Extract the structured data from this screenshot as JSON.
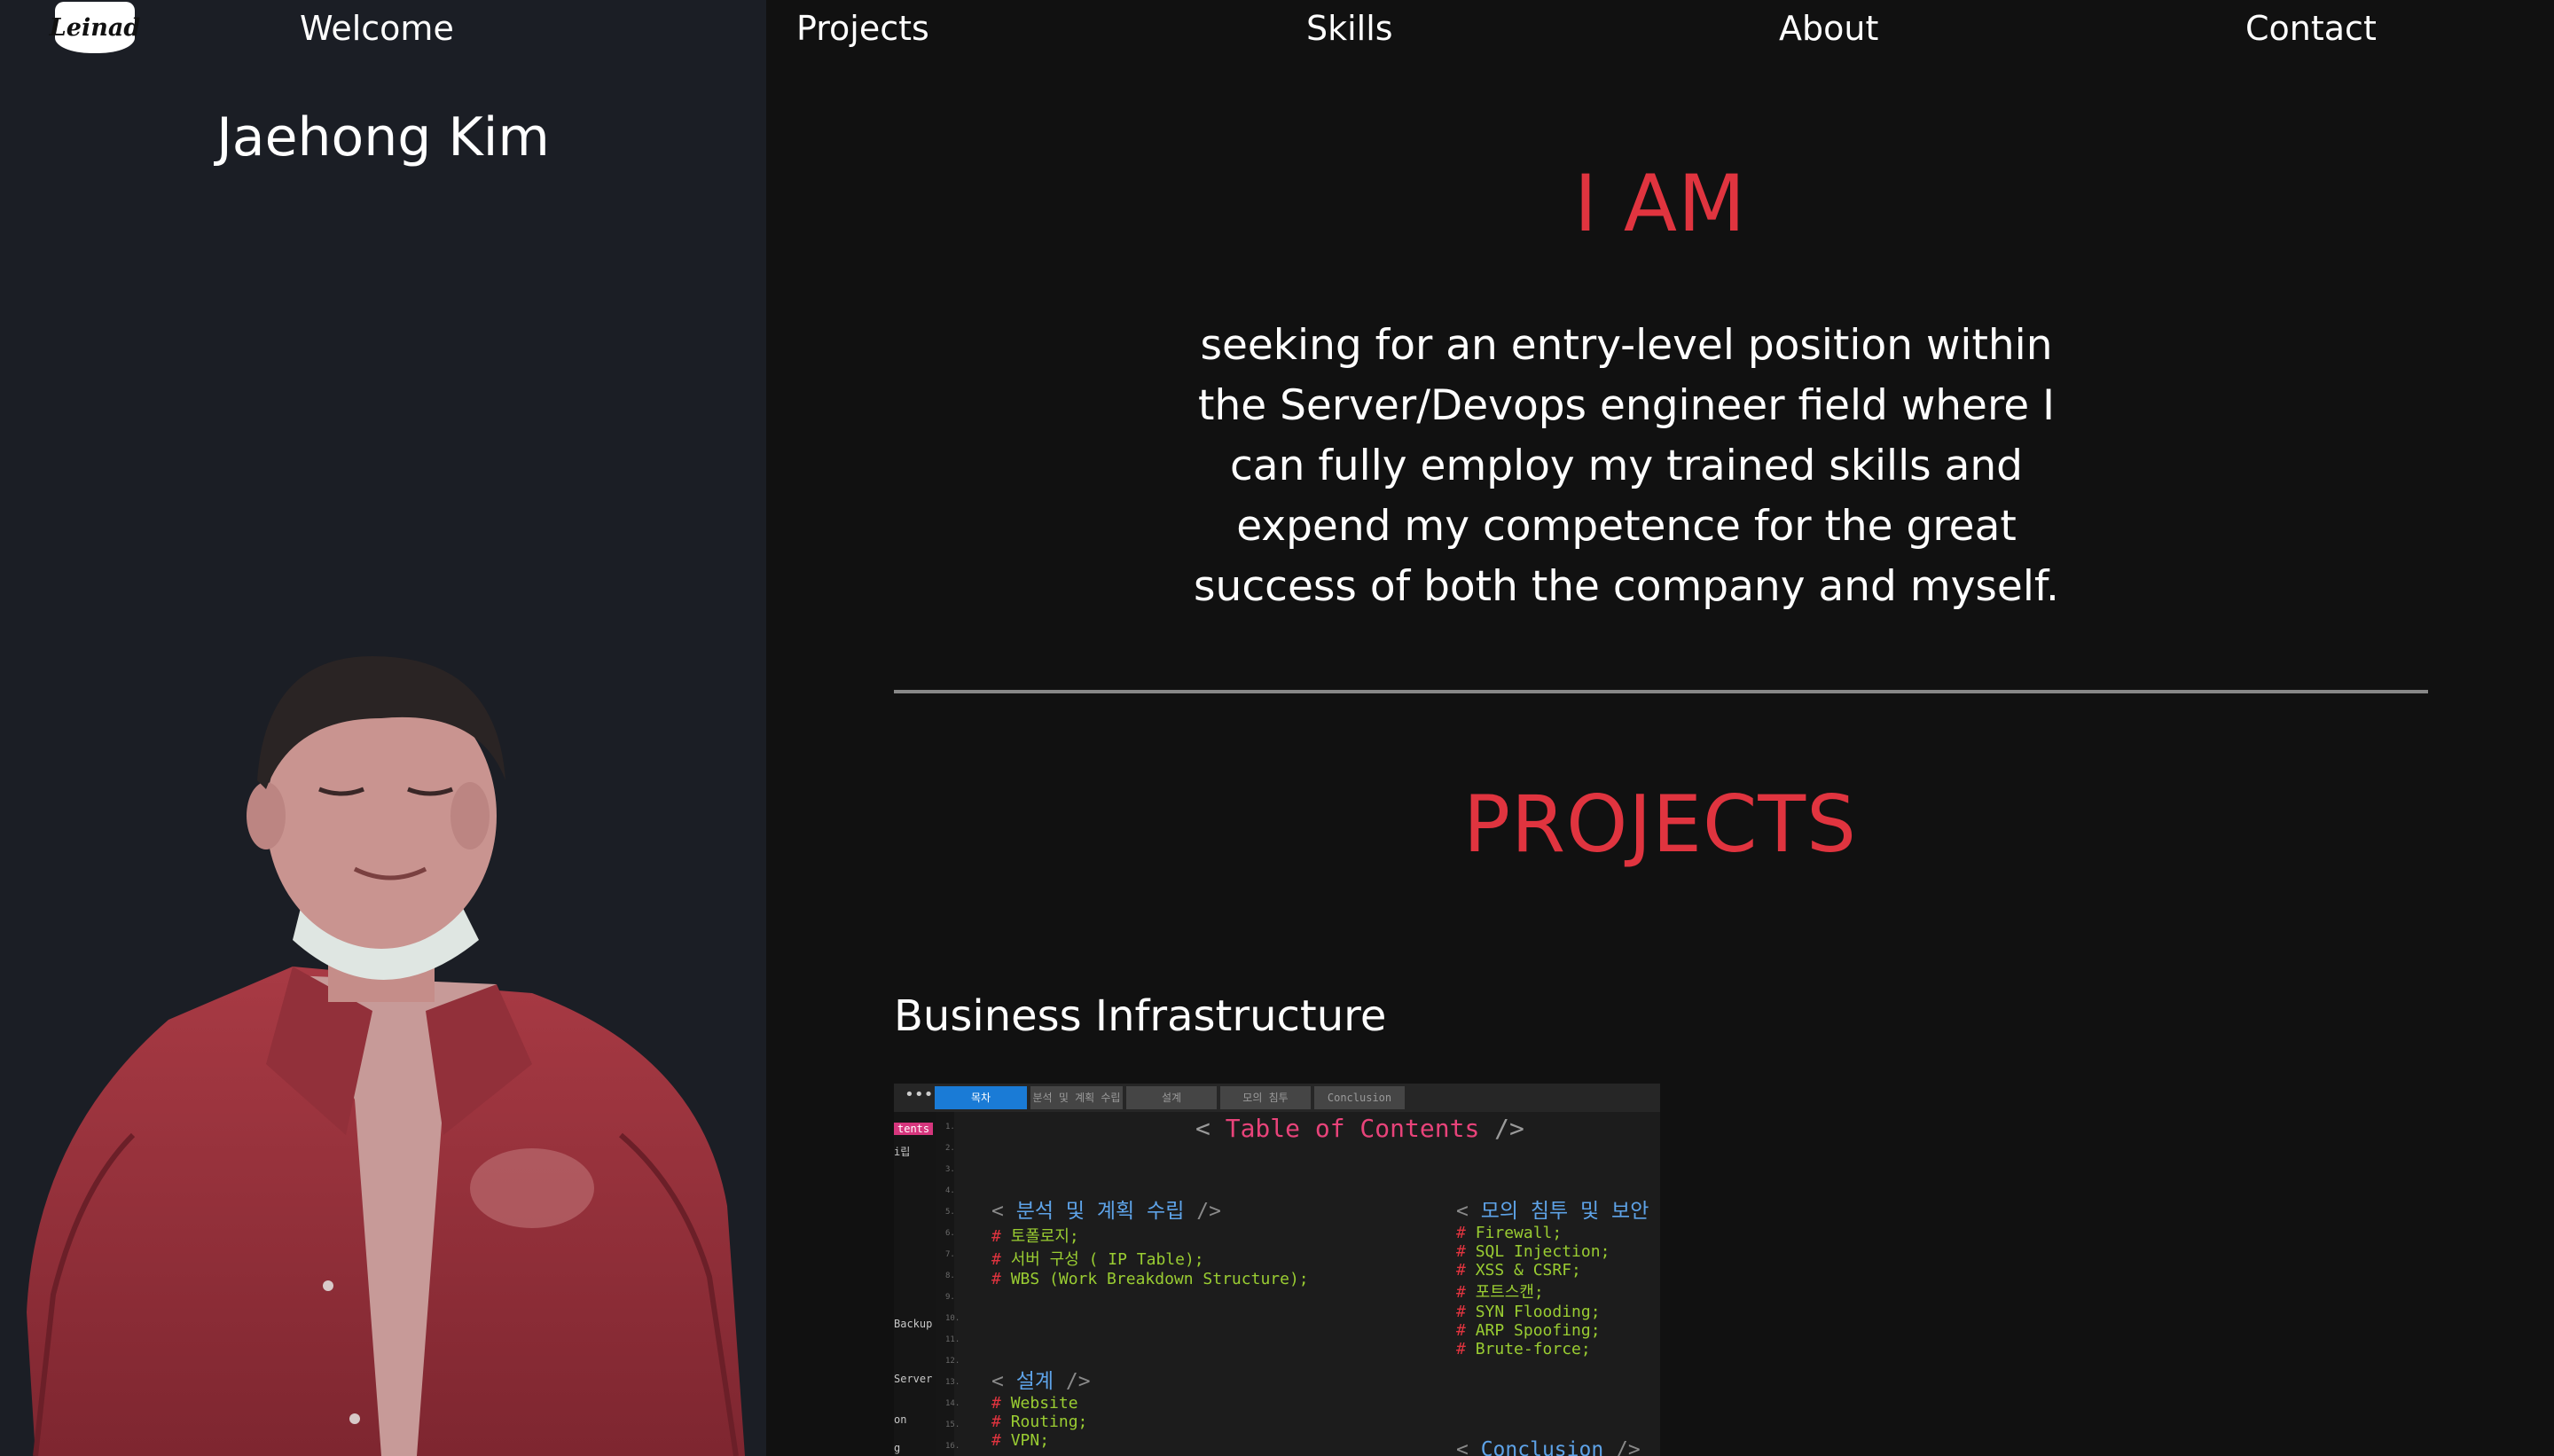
{
  "nav": {
    "logo_text": "Leinad",
    "items": [
      "Welcome",
      "Projects",
      "Skills",
      "About",
      "Contact"
    ]
  },
  "sidebar": {
    "name": "Jaehong Kim"
  },
  "intro": {
    "title": "I AM",
    "lines": [
      "seeking for an entry-level position within",
      "the Server/Devops engineer field where I",
      "can fully employ my trained skills and",
      "expend my competence for the great",
      "success of both the company and myself."
    ]
  },
  "projects": {
    "title": "PROJECTS",
    "items": [
      {
        "title": "Business Infrastructure",
        "preview": {
          "tabs": [
            "목차",
            "분석 및 계획 수립",
            "설계",
            "모의 침투",
            "Conclusion"
          ],
          "side_labels": [
            "tents",
            "i립",
            "Backup",
            "Server",
            "on",
            "g"
          ],
          "line_numbers": [
            "1.",
            "2.",
            "3.",
            "4.",
            "5.",
            "6.",
            "7.",
            "8.",
            "9.",
            "10.",
            "11.",
            "12.",
            "13.",
            "14.",
            "15.",
            "16."
          ],
          "toc_open": "<",
          "toc_title": "Table of Contents",
          "toc_close": "/>",
          "sections": [
            {
              "open": "<",
              "heading": "분석 및 계획 수립",
              "close": "/>",
              "items": [
                "토폴로지;",
                "서버 구성 ( IP Table);",
                "WBS (Work Breakdown Structure);"
              ]
            },
            {
              "open": "<",
              "heading": "모의 침투 및 보안 구축",
              "close": "",
              "items": [
                "Firewall;",
                "SQL Injection;",
                "XSS & CSRF;",
                "포트스캔;",
                "SYN Flooding;",
                "ARP Spoofing;",
                "Brute-force;"
              ]
            },
            {
              "open": "<",
              "heading": "설계",
              "close": "/>",
              "items": [
                "Website",
                "Routing;",
                "VPN;"
              ]
            },
            {
              "open": "<",
              "heading": "Conclusion",
              "close": "/>",
              "items": []
            }
          ]
        }
      }
    ]
  }
}
